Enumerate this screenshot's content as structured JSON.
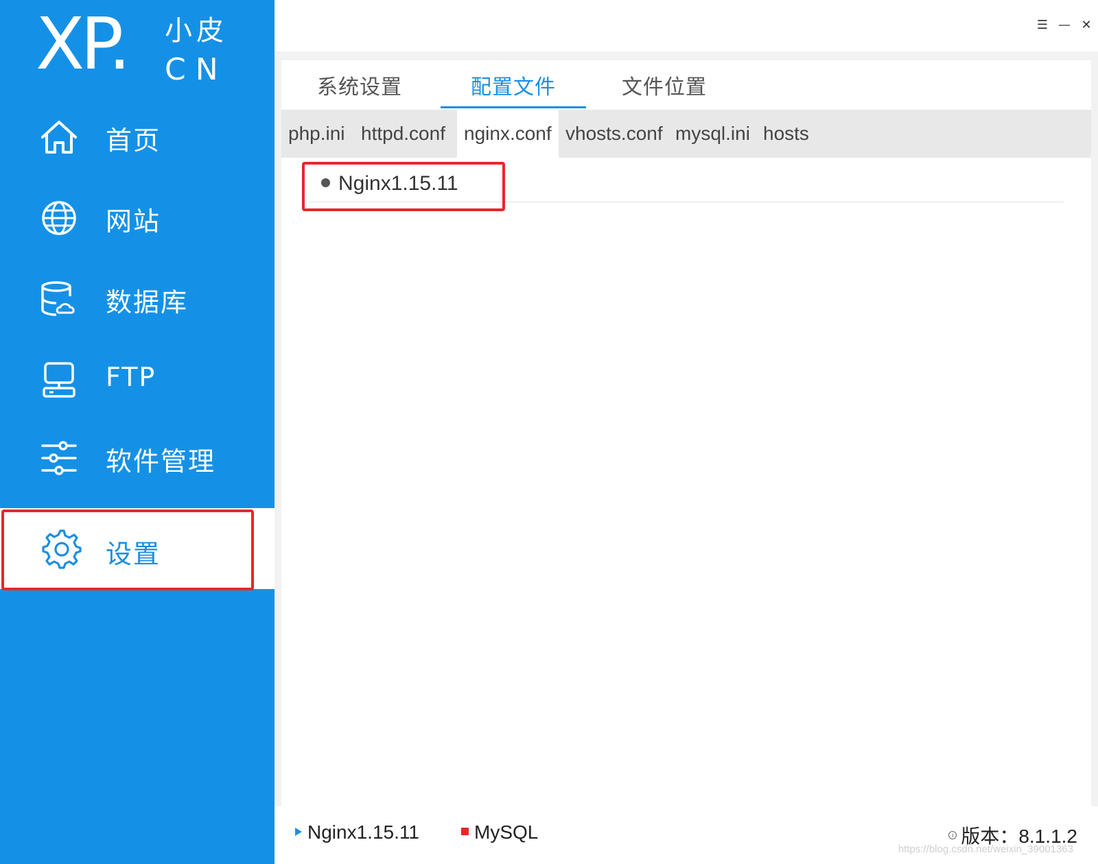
{
  "logo": {
    "main": "XP.",
    "small": "小皮",
    "cn": "CN"
  },
  "window": {
    "menu_icon": "☰",
    "minimize_icon": "—",
    "close_icon": "✕"
  },
  "sidebar": {
    "items": [
      {
        "label": "首页",
        "icon": "home-icon"
      },
      {
        "label": "网站",
        "icon": "globe-icon"
      },
      {
        "label": "数据库",
        "icon": "database-icon"
      },
      {
        "label": "FTP",
        "icon": "ftp-icon"
      },
      {
        "label": "软件管理",
        "icon": "sliders-icon"
      },
      {
        "label": "设置",
        "icon": "gear-icon",
        "active": true
      }
    ]
  },
  "top_tabs": [
    {
      "label": "系统设置"
    },
    {
      "label": "配置文件",
      "active": true
    },
    {
      "label": "文件位置"
    }
  ],
  "sub_tabs": [
    {
      "label": "php.ini"
    },
    {
      "label": "httpd.conf"
    },
    {
      "label": "nginx.conf",
      "active": true
    },
    {
      "label": "vhosts.conf"
    },
    {
      "label": "mysql.ini"
    },
    {
      "label": "hosts"
    }
  ],
  "content": {
    "entry": "Nginx1.15.11"
  },
  "status": {
    "nginx": "Nginx1.15.11",
    "mysql": "MySQL",
    "version_label": "版本：",
    "version": "8.1.1.2"
  },
  "watermark": "https://blog.csdn.net/weixin_39001363",
  "colors": {
    "accent": "#1491e6",
    "highlight": "#e8262a"
  }
}
